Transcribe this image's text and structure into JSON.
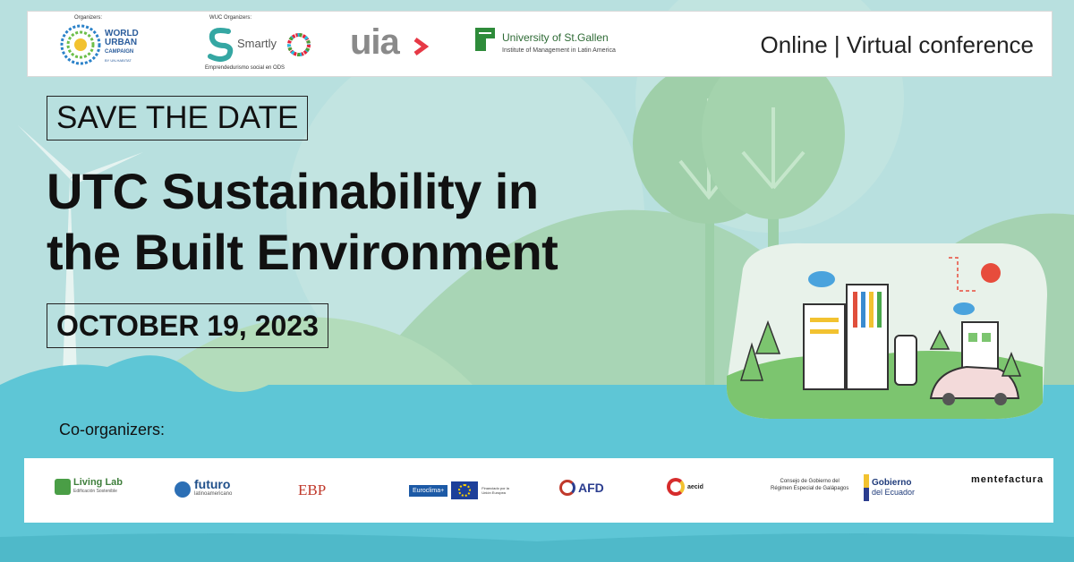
{
  "header": {
    "organizers_label": "Organizers:",
    "wuc_organizers_label": "WUC Organizers:",
    "online_text": "Online | Virtual conference",
    "logos": {
      "world_urban": [
        "WORLD",
        "URBAN",
        "CAMPAIGN"
      ],
      "world_urban_sub": "BY UN-HABITAT",
      "smartly": "Smartly",
      "smartly_sub": "Emprendedurismo social en ODS",
      "uia": "uia",
      "stgallen": "University of St.Gallen",
      "stgallen_sub": "Institute of Management in Latin America"
    }
  },
  "main": {
    "save_the_date": "SAVE THE DATE",
    "title_line1": "UTC Sustainability in",
    "title_line2": "the Built Environment",
    "date": "OCTOBER 19, 2023"
  },
  "coorganizers": {
    "label": "Co-organizers:",
    "logos": {
      "livinglab": "Living Lab",
      "livinglab_sub": "Edificación Sostenible",
      "futuro": "futuro",
      "futuro_sub": "latinoamericano",
      "ebp": "EBP",
      "euroclima": "Euroclima+",
      "eu_sub": "Financiado por la Unión Europea",
      "afd": "AFD",
      "aecid": "aecid",
      "galapagos_1": "Consejo de Gobierno del",
      "galapagos_2": "Régimen Especial de Galápagos",
      "gobierno_1": "Gobierno",
      "gobierno_2": "del Ecuador",
      "mentefactura": "mentefactura"
    }
  },
  "colors": {
    "water": "#5ec6d6",
    "sky": "#b7dfe0",
    "hill": "#a9d4b0",
    "tree": "#8cc59a"
  }
}
